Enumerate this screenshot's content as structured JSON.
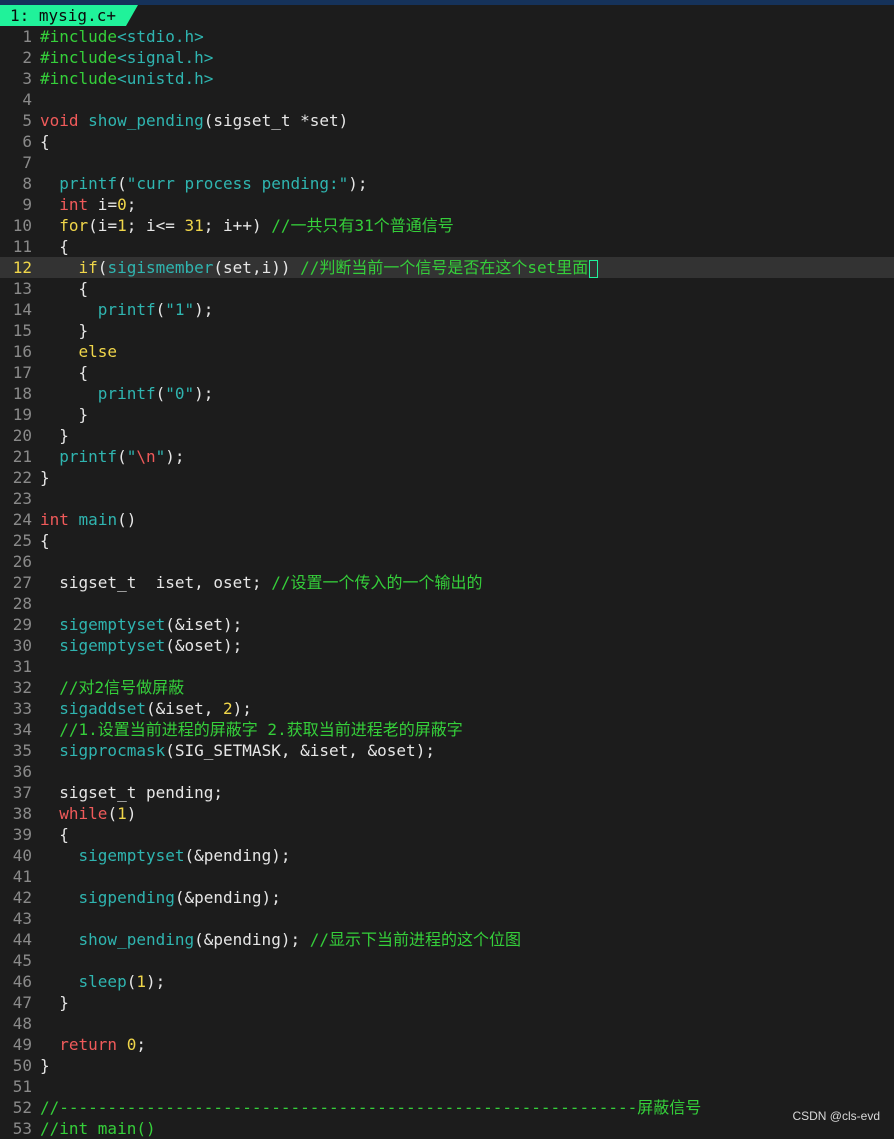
{
  "window": {
    "tab_label": "1: mysig.c+"
  },
  "watermark": "CSDN @cls-evd",
  "colors": {
    "preproc": "#35cf3a",
    "keyword": "#f0d64a",
    "type": "#f05a5a",
    "function": "#2fb5b0",
    "number": "#f0d64a",
    "string": "#2fb5b0",
    "comment": "#35cf3a",
    "cursor": "#20f29a",
    "tab_bg": "#20f29a"
  },
  "cursor_line": 12,
  "lines": [
    {
      "n": "1",
      "t": [
        [
          "pre",
          "#include"
        ],
        [
          "str",
          "<stdio.h>"
        ]
      ]
    },
    {
      "n": "2",
      "t": [
        [
          "pre",
          "#include"
        ],
        [
          "str",
          "<signal.h>"
        ]
      ]
    },
    {
      "n": "3",
      "t": [
        [
          "pre",
          "#include"
        ],
        [
          "str",
          "<unistd.h>"
        ]
      ]
    },
    {
      "n": "4",
      "t": []
    },
    {
      "n": "5",
      "t": [
        [
          "ty",
          "void"
        ],
        [
          "tx",
          " "
        ],
        [
          "fn",
          "show_pending"
        ],
        [
          "tx",
          "(sigset_t *set)"
        ]
      ]
    },
    {
      "n": "6",
      "t": [
        [
          "tx",
          "{"
        ]
      ]
    },
    {
      "n": "7",
      "t": []
    },
    {
      "n": "8",
      "t": [
        [
          "tx",
          "  "
        ],
        [
          "fn",
          "printf"
        ],
        [
          "tx",
          "("
        ],
        [
          "str",
          "\"curr process pending:\""
        ],
        [
          "tx",
          ");"
        ]
      ]
    },
    {
      "n": "9",
      "t": [
        [
          "tx",
          "  "
        ],
        [
          "ty",
          "int"
        ],
        [
          "tx",
          " i="
        ],
        [
          "num",
          "0"
        ],
        [
          "tx",
          ";"
        ]
      ]
    },
    {
      "n": "10",
      "t": [
        [
          "tx",
          "  "
        ],
        [
          "kw",
          "for"
        ],
        [
          "tx",
          "(i="
        ],
        [
          "num",
          "1"
        ],
        [
          "tx",
          "; i<= "
        ],
        [
          "num",
          "31"
        ],
        [
          "tx",
          "; i++) "
        ],
        [
          "cm",
          "//一共只有31个普通信号"
        ]
      ]
    },
    {
      "n": "11",
      "t": [
        [
          "tx",
          "  {"
        ]
      ]
    },
    {
      "n": "12",
      "t": [
        [
          "tx",
          "    "
        ],
        [
          "kw",
          "if"
        ],
        [
          "tx",
          "("
        ],
        [
          "fn",
          "sigismember"
        ],
        [
          "tx",
          "(set,i)) "
        ],
        [
          "cm",
          "//判断当前一个信号是否在这个set里面"
        ]
      ]
    },
    {
      "n": "13",
      "t": [
        [
          "tx",
          "    {"
        ]
      ]
    },
    {
      "n": "14",
      "t": [
        [
          "tx",
          "      "
        ],
        [
          "fn",
          "printf"
        ],
        [
          "tx",
          "("
        ],
        [
          "str",
          "\"1\""
        ],
        [
          "tx",
          ");"
        ]
      ]
    },
    {
      "n": "15",
      "t": [
        [
          "tx",
          "    }"
        ]
      ]
    },
    {
      "n": "16",
      "t": [
        [
          "tx",
          "    "
        ],
        [
          "kw",
          "else"
        ]
      ]
    },
    {
      "n": "17",
      "t": [
        [
          "tx",
          "    {"
        ]
      ]
    },
    {
      "n": "18",
      "t": [
        [
          "tx",
          "      "
        ],
        [
          "fn",
          "printf"
        ],
        [
          "tx",
          "("
        ],
        [
          "str",
          "\"0\""
        ],
        [
          "tx",
          ");"
        ]
      ]
    },
    {
      "n": "19",
      "t": [
        [
          "tx",
          "    }"
        ]
      ]
    },
    {
      "n": "20",
      "t": [
        [
          "tx",
          "  }"
        ]
      ]
    },
    {
      "n": "21",
      "t": [
        [
          "tx",
          "  "
        ],
        [
          "fn",
          "printf"
        ],
        [
          "tx",
          "("
        ],
        [
          "str",
          "\""
        ],
        [
          "esc",
          "\\n"
        ],
        [
          "str",
          "\""
        ],
        [
          "tx",
          ");"
        ]
      ]
    },
    {
      "n": "22",
      "t": [
        [
          "tx",
          "}"
        ]
      ]
    },
    {
      "n": "23",
      "t": []
    },
    {
      "n": "24",
      "t": [
        [
          "ty",
          "int"
        ],
        [
          "tx",
          " "
        ],
        [
          "fn",
          "main"
        ],
        [
          "tx",
          "()"
        ]
      ]
    },
    {
      "n": "25",
      "t": [
        [
          "tx",
          "{"
        ]
      ]
    },
    {
      "n": "26",
      "t": []
    },
    {
      "n": "27",
      "t": [
        [
          "tx",
          "  sigset_t  iset, oset; "
        ],
        [
          "cm",
          "//设置一个传入的一个输出的"
        ]
      ]
    },
    {
      "n": "28",
      "t": []
    },
    {
      "n": "29",
      "t": [
        [
          "tx",
          "  "
        ],
        [
          "fn",
          "sigemptyset"
        ],
        [
          "tx",
          "(&iset);"
        ]
      ]
    },
    {
      "n": "30",
      "t": [
        [
          "tx",
          "  "
        ],
        [
          "fn",
          "sigemptyset"
        ],
        [
          "tx",
          "(&oset);"
        ]
      ]
    },
    {
      "n": "31",
      "t": []
    },
    {
      "n": "32",
      "t": [
        [
          "tx",
          "  "
        ],
        [
          "cm",
          "//对2信号做屏蔽"
        ]
      ]
    },
    {
      "n": "33",
      "t": [
        [
          "tx",
          "  "
        ],
        [
          "fn",
          "sigaddset"
        ],
        [
          "tx",
          "(&iset, "
        ],
        [
          "num",
          "2"
        ],
        [
          "tx",
          ");"
        ]
      ]
    },
    {
      "n": "34",
      "t": [
        [
          "tx",
          "  "
        ],
        [
          "cm",
          "//1.设置当前进程的屏蔽字 2.获取当前进程老的屏蔽字"
        ]
      ]
    },
    {
      "n": "35",
      "t": [
        [
          "tx",
          "  "
        ],
        [
          "fn",
          "sigprocmask"
        ],
        [
          "tx",
          "(SIG_SETMASK, &iset, &oset);"
        ]
      ]
    },
    {
      "n": "36",
      "t": []
    },
    {
      "n": "37",
      "t": [
        [
          "tx",
          "  sigset_t pending;"
        ]
      ]
    },
    {
      "n": "38",
      "t": [
        [
          "tx",
          "  "
        ],
        [
          "ty",
          "while"
        ],
        [
          "tx",
          "("
        ],
        [
          "num",
          "1"
        ],
        [
          "tx",
          ")"
        ]
      ]
    },
    {
      "n": "39",
      "t": [
        [
          "tx",
          "  {"
        ]
      ]
    },
    {
      "n": "40",
      "t": [
        [
          "tx",
          "    "
        ],
        [
          "fn",
          "sigemptyset"
        ],
        [
          "tx",
          "(&pending);"
        ]
      ]
    },
    {
      "n": "41",
      "t": []
    },
    {
      "n": "42",
      "t": [
        [
          "tx",
          "    "
        ],
        [
          "fn",
          "sigpending"
        ],
        [
          "tx",
          "(&pending);"
        ]
      ]
    },
    {
      "n": "43",
      "t": []
    },
    {
      "n": "44",
      "t": [
        [
          "tx",
          "    "
        ],
        [
          "fn",
          "show_pending"
        ],
        [
          "tx",
          "(&pending); "
        ],
        [
          "cm",
          "//显示下当前进程的这个位图"
        ]
      ]
    },
    {
      "n": "45",
      "t": []
    },
    {
      "n": "46",
      "t": [
        [
          "tx",
          "    "
        ],
        [
          "fn",
          "sleep"
        ],
        [
          "tx",
          "("
        ],
        [
          "num",
          "1"
        ],
        [
          "tx",
          ");"
        ]
      ]
    },
    {
      "n": "47",
      "t": [
        [
          "tx",
          "  }"
        ]
      ]
    },
    {
      "n": "48",
      "t": []
    },
    {
      "n": "49",
      "t": [
        [
          "tx",
          "  "
        ],
        [
          "ty",
          "return"
        ],
        [
          "tx",
          " "
        ],
        [
          "num",
          "0"
        ],
        [
          "tx",
          ";"
        ]
      ]
    },
    {
      "n": "50",
      "t": [
        [
          "tx",
          "}"
        ]
      ]
    },
    {
      "n": "51",
      "t": []
    },
    {
      "n": "52",
      "t": [
        [
          "cm",
          "//------------------------------------------------------------屏蔽信号"
        ]
      ]
    },
    {
      "n": "53",
      "t": [
        [
          "cm",
          "//int main()"
        ]
      ]
    }
  ]
}
